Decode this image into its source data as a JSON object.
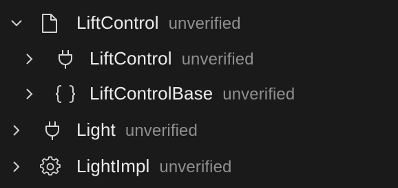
{
  "tree": {
    "items": [
      {
        "label": "LiftControl",
        "description": "unverified",
        "icon": "file-icon",
        "expanded": true
      },
      {
        "label": "LiftControl",
        "description": "unverified",
        "icon": "plug-icon",
        "expanded": false
      },
      {
        "label": "LiftControlBase",
        "description": "unverified",
        "icon": "braces-icon",
        "expanded": false
      },
      {
        "label": "Light",
        "description": "unverified",
        "icon": "plug-icon",
        "expanded": false
      },
      {
        "label": "LightImpl",
        "description": "unverified",
        "icon": "gear-icon",
        "expanded": false
      }
    ]
  },
  "colors": {
    "background": "#1a1a1a",
    "label": "#ececec",
    "description": "#8f8f8f",
    "icon": "#d4d4d4"
  }
}
